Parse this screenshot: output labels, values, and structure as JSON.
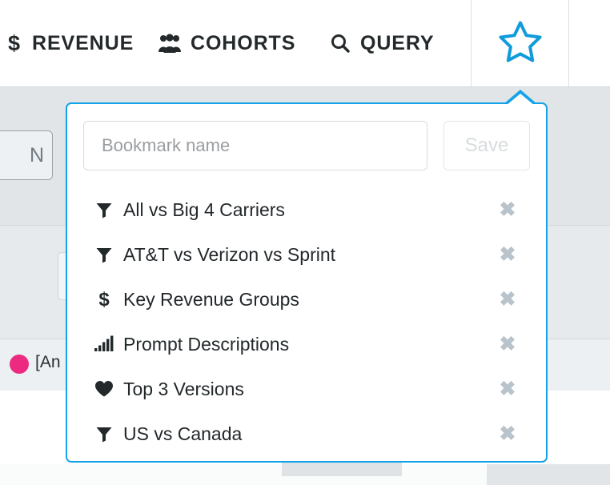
{
  "topnav": {
    "items": [
      {
        "id": "revenue",
        "label": "REVENUE",
        "icon": "dollar-icon"
      },
      {
        "id": "cohorts",
        "label": "COHORTS",
        "icon": "users-icon"
      },
      {
        "id": "query",
        "label": "QUERY",
        "icon": "search-icon"
      }
    ],
    "star_icon": "star-outline-icon",
    "star_color": "#0f9bdc"
  },
  "popup": {
    "border_color": "#14a3e8",
    "name_input": {
      "value": "",
      "placeholder": "Bookmark name"
    },
    "save_label": "Save",
    "save_enabled": false,
    "delete_icon_glyph": "✖",
    "items": [
      {
        "icon": "funnel-icon",
        "label": "All vs Big 4 Carriers"
      },
      {
        "icon": "funnel-icon",
        "label": "AT&T vs Verizon vs Sprint"
      },
      {
        "icon": "dollar-icon",
        "label": "Key Revenue Groups"
      },
      {
        "icon": "signal-bars-icon",
        "label": "Prompt Descriptions"
      },
      {
        "icon": "heart-icon",
        "label": "Top 3 Versions"
      },
      {
        "icon": "funnel-icon",
        "label": "US vs Canada"
      }
    ]
  },
  "background": {
    "left_button_label": "N",
    "legend_dot_color": "#ec2a7f",
    "legend_label": "[An"
  }
}
